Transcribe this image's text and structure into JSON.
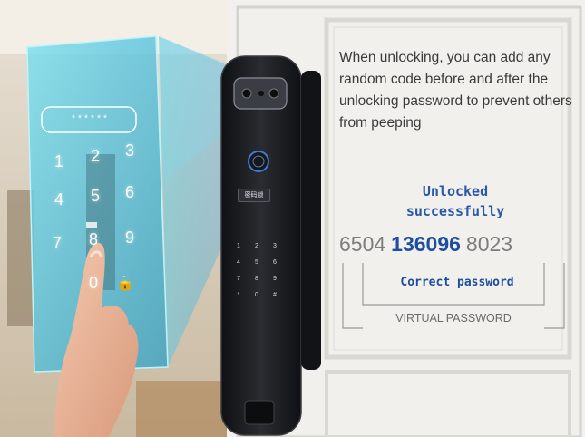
{
  "caption": "When unlocking, you can add any random code before and after the unlocking password to prevent others from peeping",
  "status": "Unlocked successfully",
  "codes": {
    "prefix": "6504",
    "password": "136096",
    "suffix": "8023"
  },
  "correct_label": "Correct password",
  "virtual_label": "VIRTUAL PASSWORD",
  "hologram": {
    "masked_entry": "******",
    "keys": [
      "1",
      "2",
      "3",
      "4",
      "5",
      "6",
      "7",
      "8",
      "9",
      "0"
    ]
  },
  "lock_keypad": {
    "keys": [
      "1",
      "2",
      "3",
      "4",
      "5",
      "6",
      "7",
      "8",
      "9",
      "*",
      "0",
      "#"
    ]
  },
  "lock_badge": "密码锁",
  "colors": {
    "accent_blue": "#2b59a8",
    "hologram": "#5fd2e6",
    "lock_body": "#1b1c20"
  },
  "icons": [
    "lock-icon",
    "fingerprint-icon",
    "camera-icon"
  ]
}
